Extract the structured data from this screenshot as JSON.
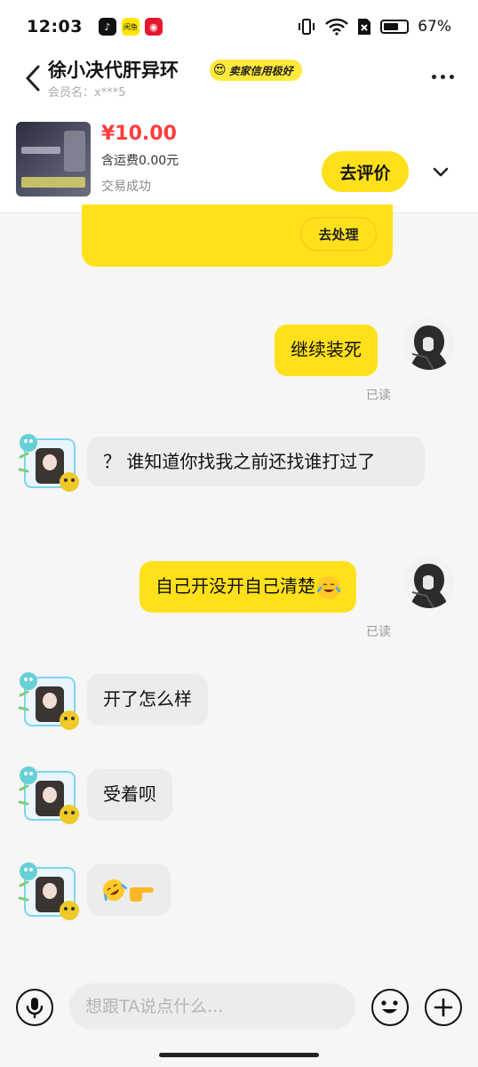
{
  "status_bar": {
    "time": "12:03",
    "apps": [
      "tiktok-icon",
      "xianyu-icon",
      "weibo-icon"
    ],
    "xianyu_label": "闲鱼",
    "battery_percent": "67%",
    "battery_level": 0.67
  },
  "header": {
    "seller_name": "徐小决代肝异环",
    "credit_badge": "卖家信用极好",
    "member_label": "会员名：",
    "member_id": "x***5"
  },
  "product": {
    "price": "¥10.00",
    "shipping": "含运费0.00元",
    "status": "交易成功",
    "review_button": "去评价"
  },
  "system_card": {
    "action_button": "去处理"
  },
  "messages": [
    {
      "from": "me",
      "text": "继续装死",
      "read": "已读"
    },
    {
      "from": "other",
      "text": "？ 谁知道你找我之前还找谁打过了"
    },
    {
      "from": "me",
      "text": "自己开没开自己清楚",
      "emoji": "laughing-with-tears",
      "read": "已读"
    },
    {
      "from": "other",
      "text": "开了怎么样"
    },
    {
      "from": "other",
      "text": "受着呗"
    },
    {
      "from": "other",
      "text": "",
      "emojis": [
        "rolling-on-floor-laughing",
        "pointing-right-hand"
      ]
    }
  ],
  "input_bar": {
    "placeholder": "想跟TA说点什么..."
  },
  "colors": {
    "accent_yellow": "#ffe01b",
    "price_red": "#ff3d3d",
    "incoming_bubble": "#ececec",
    "background": "#f6f6f6"
  }
}
